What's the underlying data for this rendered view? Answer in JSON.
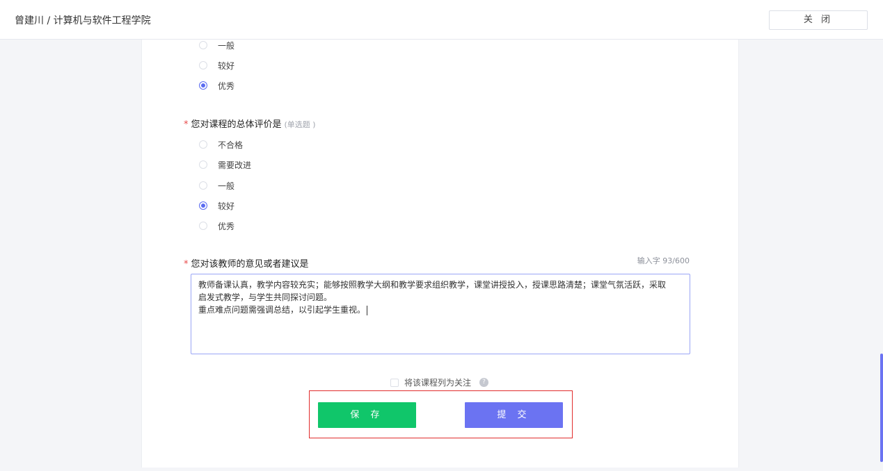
{
  "header": {
    "title": "曾建川 / 计算机与软件工程学院",
    "close_label": "关 闭"
  },
  "question_prev": {
    "options": [
      {
        "label": "一般",
        "checked": false
      },
      {
        "label": "较好",
        "checked": false
      },
      {
        "label": "优秀",
        "checked": true
      }
    ]
  },
  "question_overall": {
    "star": "*",
    "text": "您对课程的总体评价是",
    "hint": "(单选题 )",
    "options": [
      {
        "label": "不合格",
        "checked": false
      },
      {
        "label": "需要改进",
        "checked": false
      },
      {
        "label": "一般",
        "checked": false
      },
      {
        "label": "较好",
        "checked": true
      },
      {
        "label": "优秀",
        "checked": false
      }
    ]
  },
  "question_suggestion": {
    "star": "*",
    "text": "您对该教师的意见或者建议是",
    "char_count": "输入字 93/600",
    "lines": [
      "教师备课认真，教学内容较充实；能够按照教学大纲和教学要求组织教学，课堂讲授投入，授课思路清楚；课堂气氛活跃，采取",
      "启发式教学，与学生共同探讨问题。",
      "重点难点问题需强调总结，以引起学生重视。"
    ]
  },
  "follow": {
    "label": "将该课程列为关注",
    "help": "?"
  },
  "actions": {
    "save_label": "保 存",
    "submit_label": "提 交"
  },
  "colors": {
    "accent": "#6b73f2",
    "save": "#10c66a",
    "highlight_box": "#e12b2b",
    "required": "#e84a4a"
  }
}
